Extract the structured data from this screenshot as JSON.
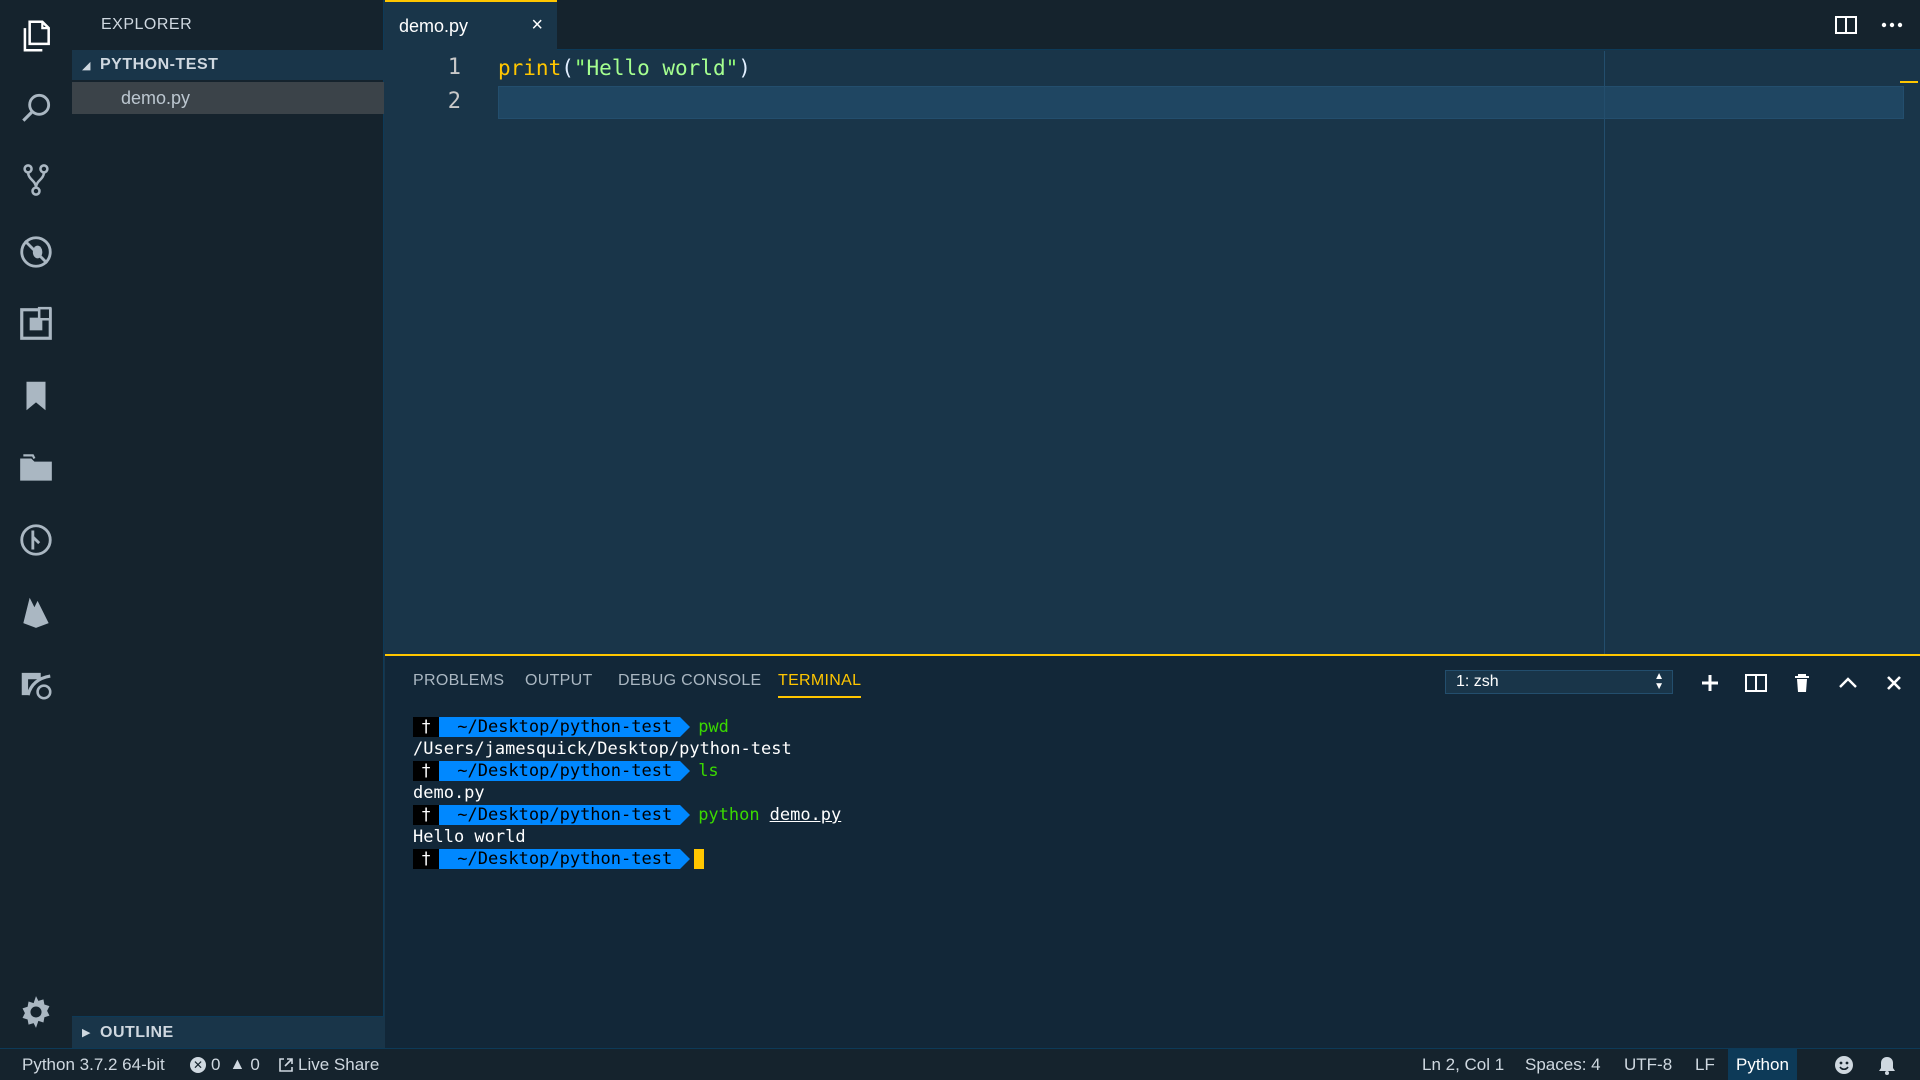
{
  "explorer": {
    "title": "EXPLORER",
    "folder": "PYTHON-TEST",
    "file": "demo.py",
    "outline": "OUTLINE"
  },
  "tabs": [
    {
      "label": "demo.py",
      "close": "×"
    }
  ],
  "editor": {
    "line_numbers": [
      "1",
      "2"
    ],
    "code": {
      "fn": "print",
      "open": "(",
      "quote_open": "\"",
      "string": "Hello world",
      "quote_close": "\"",
      "close": ")"
    }
  },
  "panel": {
    "tabs": [
      "PROBLEMS",
      "OUTPUT",
      "DEBUG CONSOLE",
      "TERMINAL"
    ],
    "active_tab": "TERMINAL",
    "terminal_select": "1: zsh",
    "terminal": {
      "user_glyph": "†",
      "path": "~/Desktop/python-test",
      "lines": [
        {
          "type": "prompt",
          "cmd": "pwd",
          "arg": ""
        },
        {
          "type": "output",
          "text": "/Users/jamesquick/Desktop/python-test"
        },
        {
          "type": "prompt",
          "cmd": "ls",
          "arg": ""
        },
        {
          "type": "output",
          "text": "demo.py"
        },
        {
          "type": "prompt",
          "cmd": "python",
          "arg": "demo.py"
        },
        {
          "type": "output",
          "text": "Hello world"
        },
        {
          "type": "prompt",
          "cmd": "",
          "arg": "",
          "cursor": true
        }
      ]
    }
  },
  "status": {
    "interpreter": "Python 3.7.2 64-bit",
    "errors": "0",
    "warnings": "0",
    "live_share": "Live Share",
    "position": "Ln 2, Col 1",
    "spaces": "Spaces: 4",
    "encoding": "UTF-8",
    "eol": "LF",
    "language": "Python"
  },
  "colors": {
    "accent": "#ffc600",
    "background": "#193549",
    "sidebar": "#15232d",
    "panel": "#122738",
    "path_segment": "#0088ff",
    "command": "#3ad900"
  }
}
